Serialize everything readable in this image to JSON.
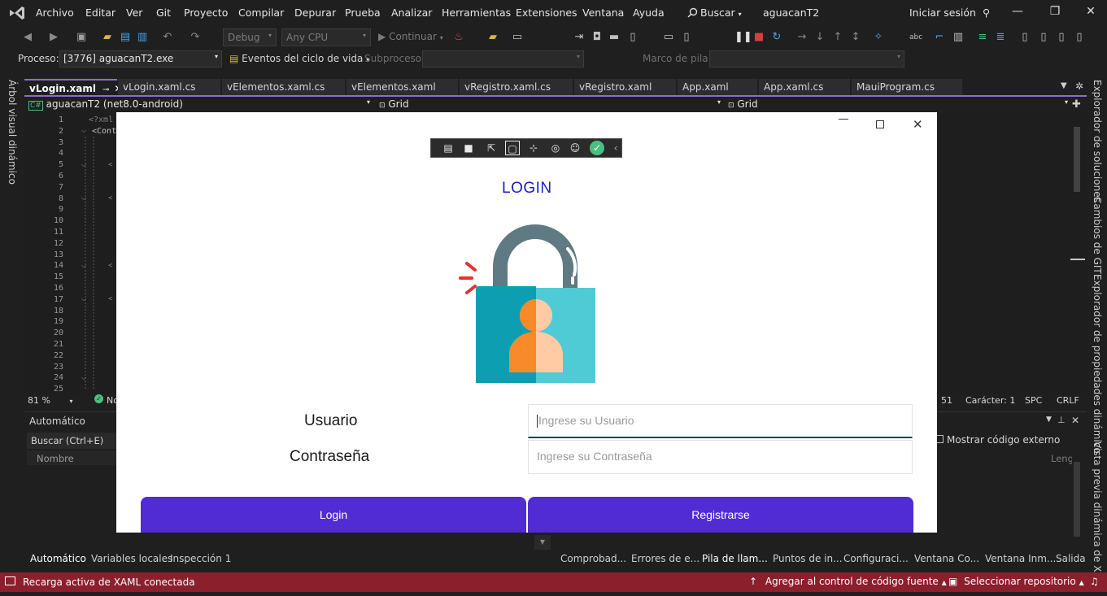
{
  "menu": {
    "items": [
      "Archivo",
      "Editar",
      "Ver",
      "Git",
      "Proyecto",
      "Compilar",
      "Depurar",
      "Prueba",
      "Analizar",
      "Herramientas",
      "Extensiones",
      "Ventana",
      "Ayuda"
    ],
    "search_label": "Buscar",
    "project_name": "aguacanT2",
    "signin_label": "Iniciar sesión"
  },
  "toolbar": {
    "config": "Debug",
    "platform": "Any CPU",
    "continue_label": "Continuar"
  },
  "debug_toolbar": {
    "process_label": "Proceso:",
    "process_value": "[3776] aguacanT2.exe",
    "lifecycle_label": "Eventos del ciclo de vida",
    "thread_label": "Subproceso:",
    "stack_label": "Marco de pila:"
  },
  "left_panel": {
    "vtab": "Árbol visual dinámico"
  },
  "right_panel": {
    "vtabs": [
      "Explorador de soluciones",
      "Cambios de GIT",
      "Explorador de propiedades dinámico",
      "Vista previa dinámica de XAM"
    ]
  },
  "doc_tabs": [
    "vLogin.xaml",
    "vLogin.xaml.cs",
    "vElementos.xaml.cs",
    "vElementos.xaml",
    "vRegistro.xaml.cs",
    "vRegistro.xaml",
    "App.xaml",
    "App.xaml.cs",
    "MauiProgram.cs"
  ],
  "nav": {
    "project": "aguacanT2 (net8.0-android)",
    "left_scope": "Grid",
    "right_scope": "Grid"
  },
  "editor": {
    "line_numbers": [
      "1",
      "2",
      "3",
      "4",
      "5",
      "6",
      "7",
      "8",
      "9",
      "10",
      "11",
      "12",
      "13",
      "14",
      "15",
      "16",
      "17",
      "18",
      "19",
      "20",
      "21",
      "22",
      "23",
      "24",
      "25"
    ],
    "code_line1": "<?xml",
    "code_line2": "<Conte",
    "zoom": "81 %",
    "status_left": "No",
    "position": "51",
    "caret": "Carácter: 1",
    "whitespace": "SPC",
    "eol": "CRLF"
  },
  "bottom_panel": {
    "title": "Automático",
    "search_placeholder": "Buscar (Ctrl+E)",
    "col_name": "Nombre",
    "col_lang": "Leng",
    "show_external": "Mostrar código externo",
    "tabs_left": [
      "Automático",
      "Variables locales",
      "Inspección 1"
    ],
    "tabs_right": [
      "Comprobad...",
      "Errores de e...",
      "Pila de llam...",
      "Puntos de in...",
      "Configuraci...",
      "Ventana Co...",
      "Ventana Inm...",
      "Salida"
    ]
  },
  "statusbar": {
    "left": "Recarga activa de XAML conectada",
    "source_control": "Agregar al control de código fuente",
    "repo": "Seleccionar repositorio"
  },
  "app": {
    "title": "LOGIN",
    "user_label": "Usuario",
    "user_placeholder": "Ingrese su Usuario",
    "password_label": "Contraseña",
    "password_placeholder": "Ingrese su Contraseña",
    "login_button": "Login",
    "register_button": "Registrarse",
    "accent_color": "#512bd4",
    "title_color": "#1a1ac8"
  },
  "colors": {
    "statusbar": "#8b1f2c",
    "tab_accent": "#8a6cd6"
  }
}
